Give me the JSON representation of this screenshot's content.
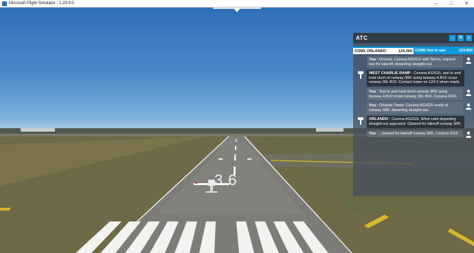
{
  "window": {
    "title": "Microsoft Flight Simulator - 1.29.9.0",
    "minimize_glyph": "–",
    "maximize_glyph": "□",
    "close_glyph": "✕"
  },
  "runway": {
    "number": "36"
  },
  "atc_panel": {
    "title": "ATC",
    "com1": {
      "label": "COM1 ORLANDO",
      "frequency": "124.300"
    },
    "com2": {
      "label": "COM2 Not in use",
      "frequency": "124.850"
    },
    "messages": [
      {
        "speaker": "You",
        "text": " : Ground, Cessna ASXGS with Sierra, request taxi for takeoff, departing straight-out."
      },
      {
        "speaker": "WEST CHARLIE RAMP",
        "text": " : Cessna ASXGS, taxi to and hold short of runway 36R using taxiway A B10 cross runway 36L B10. Contact tower on 124.3 when ready."
      },
      {
        "speaker": "You",
        "text": " : Taxi to and hold short runway 36R using taxiway A B10 cross runway 36L B10, Cessna XGS."
      },
      {
        "speaker": "You",
        "text": " : Orlando Tower, Cessna ASXGS ready at runway 36R, departing straight-out."
      },
      {
        "speaker": "ORLANDO",
        "text": " : Cessna ASXGS, Wind calm departing straight-out approved. Cleared for takeoff runway 36R"
      },
      {
        "speaker": "You",
        "text": " : , cleared for takeoff runway 36R, Cessna XGS."
      }
    ]
  },
  "colors": {
    "accent": "#0d9be0",
    "panel": "#46505c"
  }
}
